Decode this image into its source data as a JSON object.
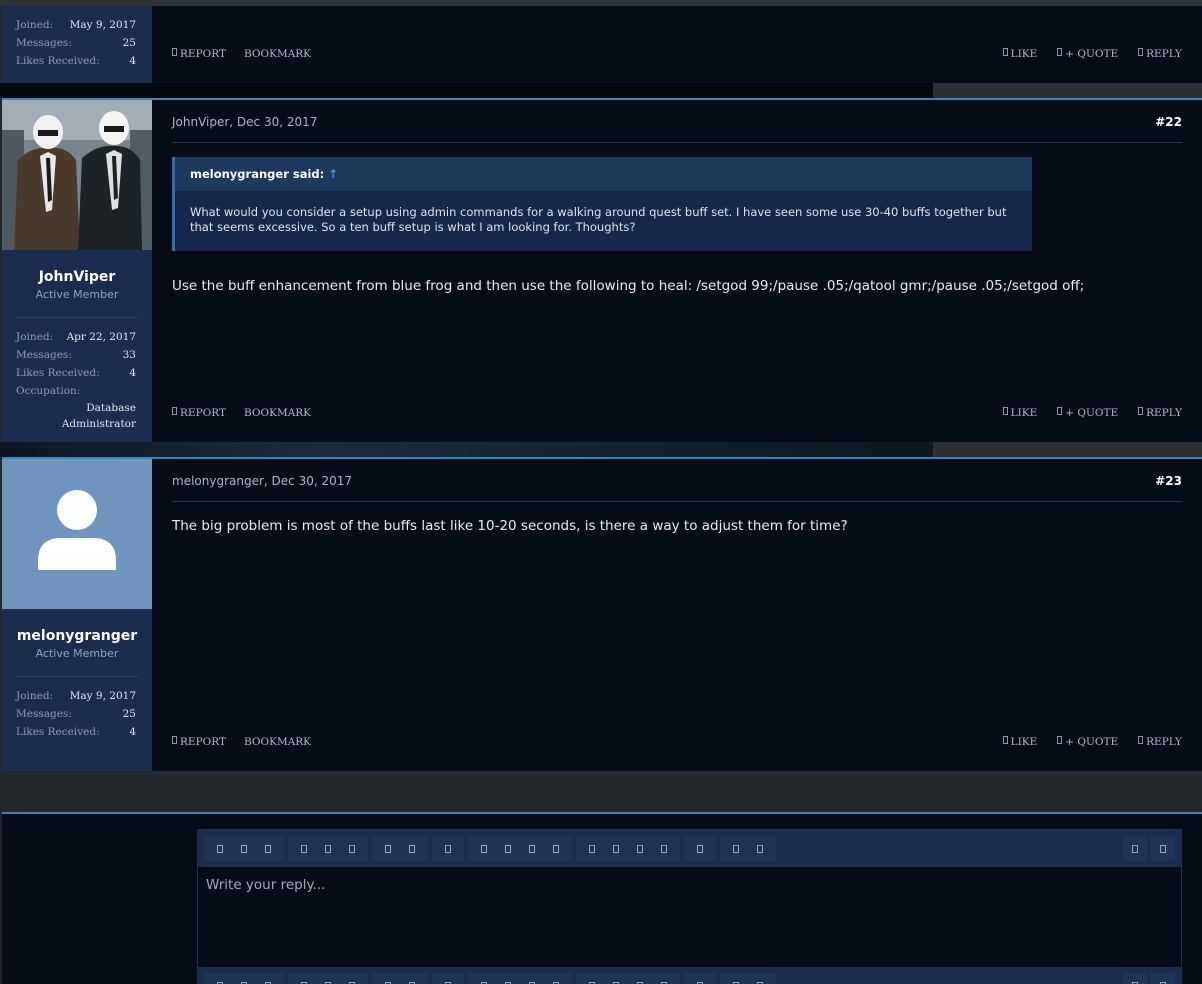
{
  "posts": [
    {
      "id": "p21",
      "stats": [
        {
          "k": "Joined:",
          "v": "May 9, 2017"
        },
        {
          "k": "Messages:",
          "v": "25"
        },
        {
          "k": "Likes Received:",
          "v": "4"
        }
      ],
      "actions_left": [
        "REPORT",
        "BOOKMARK"
      ],
      "actions_right": [
        "LIKE",
        "+ QUOTE",
        "REPLY"
      ]
    },
    {
      "id": "p22",
      "username": "JohnViper",
      "usertitle": "Active Member",
      "author_date": "JohnViper, Dec 30, 2017",
      "number": "#22",
      "quote": {
        "author": "melonygranger said:",
        "arrow": "↑",
        "text": "What would you consider a setup using admin commands for a walking around quest buff set. I have seen some use 30-40 buffs together but that seems excessive. So a ten buff setup is what I am looking for. Thoughts?"
      },
      "body": "Use the buff enhancement from blue frog and then use the following to heal: /setgod 99;/pause .05;/qatool gmr;/pause .05;/setgod off;",
      "stats": [
        {
          "k": "Joined:",
          "v": "Apr 22, 2017"
        },
        {
          "k": "Messages:",
          "v": "33"
        },
        {
          "k": "Likes Received:",
          "v": "4"
        }
      ],
      "occupation_label": "Occupation:",
      "occupation_value": "Database Administrator",
      "actions_left": [
        "REPORT",
        "BOOKMARK"
      ],
      "actions_right": [
        "LIKE",
        "+ QUOTE",
        "REPLY"
      ]
    },
    {
      "id": "p23",
      "username": "melonygranger",
      "usertitle": "Active Member",
      "author_date": "melonygranger, Dec 30, 2017",
      "number": "#23",
      "body": "The big problem is most of the buffs last like 10-20 seconds, is there a way to adjust them for time?",
      "stats": [
        {
          "k": "Joined:",
          "v": "May 9, 2017"
        },
        {
          "k": "Messages:",
          "v": "25"
        },
        {
          "k": "Likes Received:",
          "v": "4"
        }
      ],
      "actions_left": [
        "REPORT",
        "BOOKMARK"
      ],
      "actions_right": [
        "LIKE",
        "+ QUOTE",
        "REPLY"
      ]
    }
  ],
  "reply": {
    "placeholder": "Write your reply...",
    "toolbar_groups": [
      3,
      3,
      2,
      1,
      4,
      4,
      1,
      2
    ],
    "toolbar_right": 2
  },
  "colors": {
    "accent": "#3a85c0",
    "panel": "#1a2d4e",
    "background": "#070d18"
  }
}
